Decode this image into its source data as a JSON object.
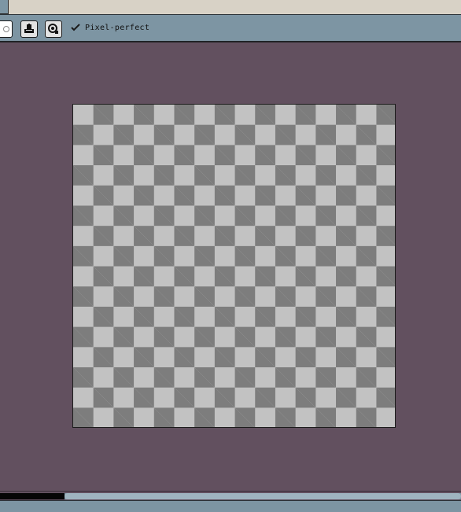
{
  "toolbar": {
    "pixel_perfect_label": "Pixel-perfect",
    "pixel_perfect_checked": true,
    "buttons": [
      {
        "icon": "ink-icon"
      },
      {
        "icon": "zoom-icon"
      }
    ]
  },
  "canvas": {
    "background": "transparent-checkerboard",
    "checker_light": "#c2c2c2",
    "checker_dark": "#7d7d7d",
    "workspace_color": "#62505f"
  },
  "colors": {
    "toolbar": "#7d95a3",
    "topbar": "#d8d2c6"
  }
}
